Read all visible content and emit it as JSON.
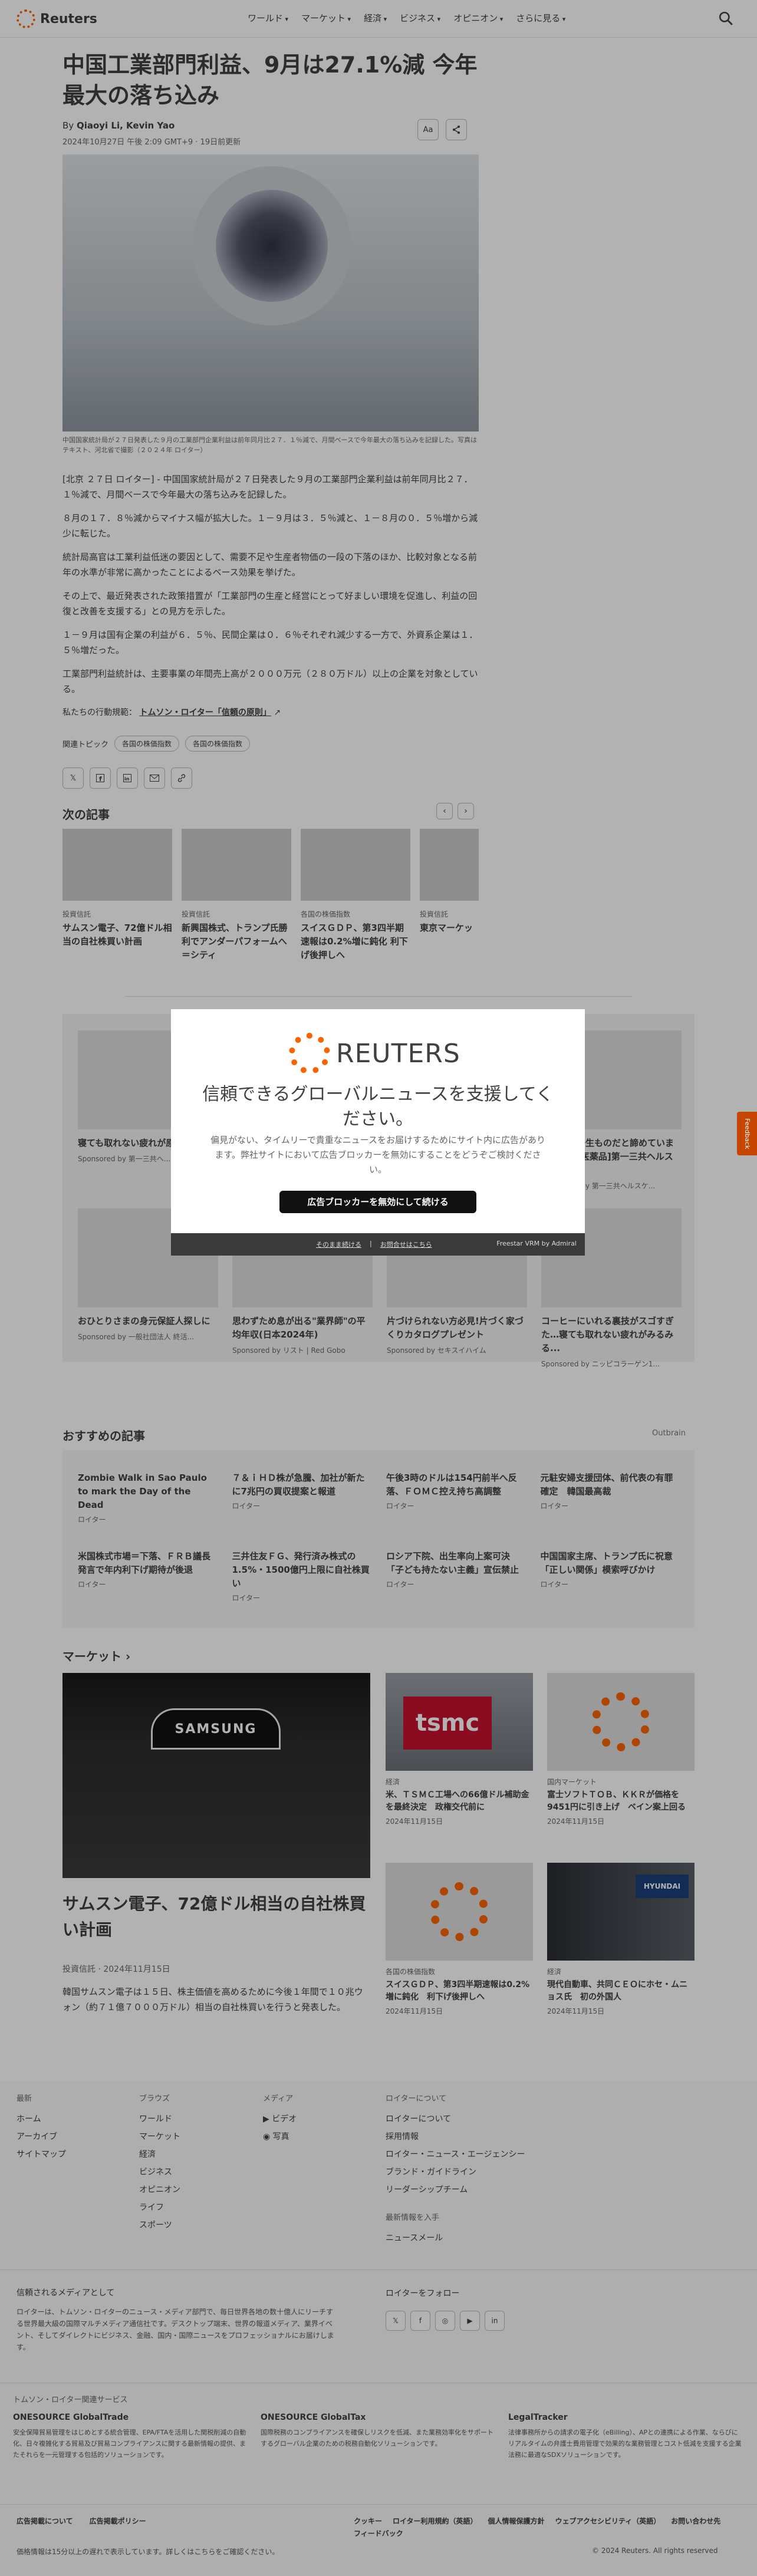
{
  "header": {
    "brand": "Reuters",
    "nav": [
      "ワールド",
      "マーケット",
      "経済",
      "ビジネス",
      "オピニオン",
      "さらに見る"
    ]
  },
  "article": {
    "title": "中国工業部門利益、9月は27.1%減 今年最大の落ち込み",
    "byline_prefix": "By",
    "authors": "Qiaoyi Li, Kevin Yao",
    "date": "2024年10月27日 午後 2:09 GMT+9 · 19日前更新",
    "tool_text_size": "Aa",
    "caption": "中国国家統計局が２７日発表した９月の工業部門企業利益は前年同月比２７．１％減で、月間ベースで今年最大の落ち込みを記録した。写真はテキスト、河北省で撮影（２０２４年 ロイター）",
    "paragraphs": [
      "[北京 ２７日 ロイター] - 中国国家統計局が２７日発表した９月の工業部門企業利益は前年同月比２７．１％減で、月間ベースで今年最大の落ち込みを記録した。",
      "８月の１７．８％減からマイナス幅が拡大した。１－９月は３．５％減と、１－８月の０．５％増から減少に転じた。",
      "統計局高官は工業利益低迷の要因として、需要不足や生産者物価の一段の下落のほか、比較対象となる前年の水準が非常に高かったことによるベース効果を挙げた。",
      "その上で、最近発表された政策措置が「工業部門の生産と経営にとって好ましい環境を促進し、利益の回復と改善を支援する」との見方を示した。",
      "１－９月は国有企業の利益が６．５％、民間企業は０．６％それぞれ減少する一方で、外資系企業は１．５％増だった。",
      "工業部門利益統計は、主要事業の年間売上高が２０００万元（２８０万ドル）以上の企業を対象としている。"
    ],
    "trust_prefix": "私たちの行動規範：",
    "trust_link": "トムソン・ロイター「信頼の原則」",
    "topics_label": "関連トピック",
    "topics": [
      "各国の株価指数",
      "各国の株価指数"
    ]
  },
  "next": {
    "heading": "次の記事",
    "items": [
      {
        "kicker": "投資信託",
        "title": "サムスン電子、72億ドル相当の自社株買い計画"
      },
      {
        "kicker": "投資信託",
        "title": "新興国株式、トランプ氏勝利でアンダーパフォームへ＝シティ"
      },
      {
        "kicker": "各国の株価指数",
        "title": "スイスＧＤＰ、第3四半期速報は0.2%増に鈍化 利下げ後押しへ"
      },
      {
        "kicker": "投資信託",
        "title": "東京マーケッ"
      }
    ]
  },
  "ads": {
    "row1": [
      {
        "title": "寝ても取れない疲れが原因かも？",
        "sponsor": "Sponsored by 第一三共ヘ..."
      },
      {
        "title": "",
        "sponsor": ""
      },
      {
        "title": "",
        "sponsor": ""
      },
      {
        "title": "あのシミ一生ものだと諦めていませんか？[医薬品]第一三共ヘルスケア開発",
        "sponsor": "Sponsored by 第一三共ヘルスケ..."
      }
    ],
    "row2": [
      {
        "title": "おひとりさまの身元保証人探しに",
        "sponsor": "Sponsored by 一般社団法人 終活..."
      },
      {
        "title": "思わずため息が出る\"業界師\"の平均年収(日本2024年)",
        "sponsor": "Sponsored by リスト | Red Gobo"
      },
      {
        "title": "片づけられない方必見!片づく家づくりカタログプレゼント",
        "sponsor": "Sponsored by セキスイハイム"
      },
      {
        "title": "コーヒーにいれる裏技がスゴすぎた…寝ても取れない疲れがみるみる...",
        "sponsor": "Sponsored by ニッピコラーゲン1..."
      }
    ]
  },
  "recommended": {
    "heading": "おすすめの記事",
    "provider": "Outbrain",
    "items": [
      {
        "title": "Zombie Walk in Sao Paulo to mark the Day of the Dead",
        "source": "ロイター"
      },
      {
        "title": "７＆ｉＨＤ株が急騰、加社が新たに7兆円の買収提案と報道",
        "source": "ロイター"
      },
      {
        "title": "午後3時のドルは154円前半へ反落、ＦＯＭＣ控え持ち高調整",
        "source": "ロイター"
      },
      {
        "title": "元駐安婦支援団体、前代表の有罪確定　韓国最高裁",
        "source": "ロイター"
      },
      {
        "title": "米国株式市場＝下落、ＦＲＢ議長発言で年内利下げ期待が後退",
        "source": "ロイター"
      },
      {
        "title": "三井住友ＦＧ、発行済み株式の1.5%・1500億円上限に自社株買い",
        "source": "ロイター"
      },
      {
        "title": "ロシア下院、出生率向上案可決 「子ども持たない主義」宣伝禁止",
        "source": "ロイター"
      },
      {
        "title": "中国国家主席、トランプ氏に祝意 「正しい関係」模索呼びかけ",
        "source": "ロイター"
      }
    ]
  },
  "market": {
    "heading": "マーケット",
    "main": {
      "sign": "SAMSUNG",
      "title": "サムスン電子、72億ドル相当の自社株買い計画",
      "kicker": "投資信託",
      "date": "2024年11月15日",
      "desc": "韓国サムスン電子は１５日、株主価値を高めるために今後１年間で１０兆ウォン（約７１億７０００万ドル）相当の自社株買いを行うと発表した。"
    },
    "cards": [
      {
        "kicker": "経済",
        "title": "米、ＴＳＭＣ工場への66億ドル補助金を最終決定　政権交代前に",
        "date": "2024年11月15日",
        "img": "tsmc"
      },
      {
        "kicker": "国内マーケット",
        "title": "富士ソフトＴＯＢ、ＫＫＲが価格を9451円に引き上げ　ベイン案上回る",
        "date": "2024年11月15日",
        "img": "reuters"
      },
      {
        "kicker": "各国の株価指数",
        "title": "スイスＧＤＰ、第3四半期速報は0.2%増に鈍化　利下げ後押しへ",
        "date": "2024年11月15日",
        "img": "reuters"
      },
      {
        "kicker": "経済",
        "title": "現代自動車、共同ＣＥＯにホセ・ムニョス氏　初の外国人",
        "date": "2024年11月15日",
        "img": "hyundai"
      }
    ]
  },
  "footer": {
    "col1": [
      "最新",
      "ホーム",
      "アーカイブ",
      "サイトマップ"
    ],
    "col2": [
      "ブラウズ",
      "ワールド",
      "マーケット",
      "経済",
      "ビジネス",
      "オピニオン",
      "ライフ",
      "スポーツ"
    ],
    "col3": [
      "メディア",
      "ビデオ",
      "写真"
    ],
    "col4": [
      "ロイターについて",
      "ロイターについて",
      "採用情報",
      "ロイター・ニュース・エージェンシー",
      "ブランド・ガイドライン",
      "リーダーシップチーム"
    ],
    "col4b": [
      "最新情報を入手",
      "ニュースメール"
    ],
    "about_title": "信頼されるメディアとして",
    "about_text": "ロイターは、トムソン・ロイターのニュース・メディア部門で、毎日世界各地の数十億人にリーチする世界最大級の国際マルチメディア通信社です。デスクトップ端末、世界の報道メディア、業界イベント、そしてダイレクトにビジネス、金融、国内・国際ニュースをプロフェッショナルにお届けします。",
    "follow": "ロイターをフォロー",
    "services_title": "トムソン・ロイター関連サービス",
    "services": [
      {
        "title": "ONESOURCE GlobalTrade",
        "text": "安全保障貿易管理をはじめとする統合管理、EPA/FTAを活用した関税削減の自動化、日々複雑化する貿易及び貿易コンプライアンスに関する最新情報の提供、またそれらを一元管理する包括的ソリューションです。"
      },
      {
        "title": "ONESOURCE GlobalTax",
        "text": "国際税務のコンプライアンスを確保しリスクを低減、また業務効率化をサポートするグローバル企業のための税務自動化ソリューションです。"
      },
      {
        "title": "LegalTracker",
        "text": "法律事務所からの請求の電子化（eBilling）、APとの連携による作業、ならびにリアルタイムの弁護士費用管理で効果的な業務管理とコスト低減を支援する企業法務に最適なSDXソリューションです。"
      }
    ],
    "legal_left": [
      "広告掲載について",
      "広告掲載ポリシー"
    ],
    "legal_right": [
      "クッキー",
      "ロイター利用規約（英語）",
      "個人情報保護方針",
      "ウェブアクセシビリティ（英語）",
      "お問い合わせ先",
      "フィードバック"
    ],
    "note": "価格情報は15分以上の遅れで表示しています。詳しくはこちらをご確認ください。",
    "copyright": "© 2024 Reuters. All rights reserved"
  },
  "modal": {
    "brand": "REUTERS",
    "title": "信頼できるグローバルニュースを支援してください。",
    "text": "偏見がない、タイムリーで貴重なニュースをお届けするためにサイト内に広告があります。弊社サイトにおいて広告ブロッカーを無効にすることをどうぞご検討ください。",
    "button": "広告ブロッカーを無効にして続ける",
    "link1": "そのまま続ける",
    "link2": "お問合せはこちら",
    "powered": "Freestar VRM  by Admiral"
  },
  "feedback": "Feedback"
}
